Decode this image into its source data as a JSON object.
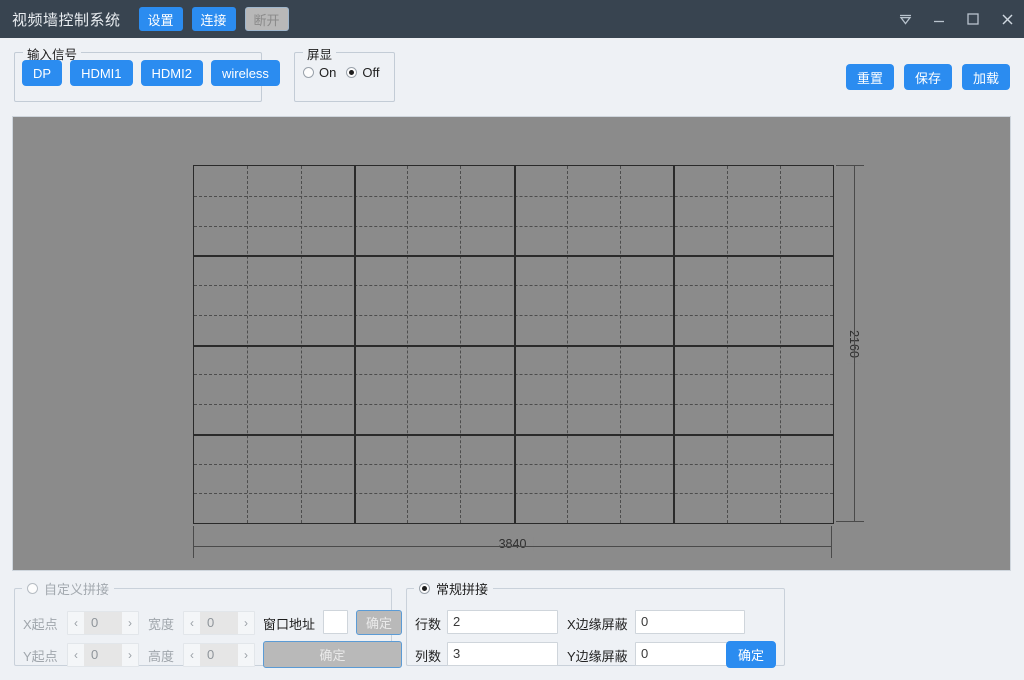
{
  "titlebar": {
    "app_title": "视频墙控制系统",
    "buttons": [
      {
        "label": "设置",
        "state": "primary",
        "name": "settings-button"
      },
      {
        "label": "连接",
        "state": "primary",
        "name": "connect-button"
      },
      {
        "label": "断开",
        "state": "disabled",
        "name": "disconnect-button"
      }
    ],
    "window_controls": [
      {
        "name": "collapse-icon",
        "glyph": "collapse"
      },
      {
        "name": "minimize-icon",
        "glyph": "minimize"
      },
      {
        "name": "maximize-icon",
        "glyph": "maximize"
      },
      {
        "name": "close-icon",
        "glyph": "close"
      }
    ]
  },
  "input_signal": {
    "legend": "输入信号",
    "buttons": [
      {
        "label": "DP"
      },
      {
        "label": "HDMI1"
      },
      {
        "label": "HDMI2"
      },
      {
        "label": "wireless"
      }
    ]
  },
  "screen_display": {
    "legend": "屏显",
    "options": [
      {
        "label": "On",
        "checked": false
      },
      {
        "label": "Off",
        "checked": true
      }
    ]
  },
  "actions": {
    "reset": "重置",
    "save": "保存",
    "load": "加载"
  },
  "wall": {
    "width_label": "3840",
    "height_label": "2160",
    "solid_rows": 4,
    "solid_cols": 4,
    "sub_rows": 3,
    "sub_cols": 3
  },
  "custom_splice": {
    "legend": "自定义拼接",
    "selected": false,
    "enabled": false,
    "fields": {
      "x_start_label": "X起点",
      "x_start_value": "0",
      "y_start_label": "Y起点",
      "y_start_value": "0",
      "width_label": "宽度",
      "width_value": "0",
      "height_label": "高度",
      "height_value": "0",
      "window_addr_label": "窗口地址",
      "window_addr_value": "",
      "prev_chevron": "‹",
      "next_chevron": "›"
    },
    "confirm_small": "确定",
    "confirm_wide": "确定"
  },
  "normal_splice": {
    "legend": "常规拼接",
    "selected": true,
    "enabled": true,
    "fields": {
      "rows_label": "行数",
      "rows_value": "2",
      "cols_label": "列数",
      "cols_value": "3",
      "x_bezel_label": "X边缘屏蔽",
      "x_bezel_value": "0",
      "y_bezel_label": "Y边缘屏蔽",
      "y_bezel_value": "0"
    },
    "confirm": "确定"
  },
  "colors": {
    "titlebar_bg": "#384450",
    "accent_blue": "#2b8cf0",
    "canvas_bg": "#8b8b8b",
    "page_bg": "#eef1f5",
    "disabled_gray": "#b8b8b8"
  }
}
